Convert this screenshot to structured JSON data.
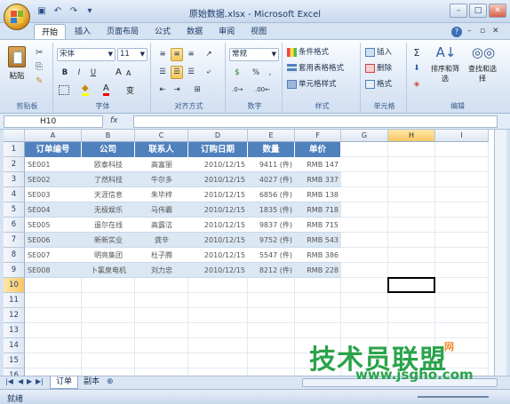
{
  "window": {
    "title": "原始数据.xlsx - Microsoft Excel"
  },
  "tabs": [
    "开始",
    "插入",
    "页面布局",
    "公式",
    "数据",
    "审阅",
    "视图"
  ],
  "ribbon": {
    "clipboard": {
      "paste": "粘贴",
      "label": "剪贴板"
    },
    "font": {
      "name": "宋体",
      "size": "11",
      "bold": "B",
      "italic": "I",
      "underline": "U",
      "label": "字体",
      "wen": "变"
    },
    "alignment": {
      "label": "对齐方式"
    },
    "number": {
      "format": "常规",
      "percent": "%",
      "comma": ",",
      "label": "数字",
      "currency": "$"
    },
    "styles": {
      "conditional": "条件格式",
      "table": "套用表格格式",
      "cell": "单元格样式",
      "label": "样式"
    },
    "cells": {
      "insert": "插入",
      "delete": "删除",
      "format": "格式",
      "label": "单元格"
    },
    "editing": {
      "sort": "排序和筛选",
      "find": "查找和选择",
      "label": "编辑",
      "sigma": "Σ"
    }
  },
  "formula_bar": {
    "name_box": "H10",
    "fx": "fx"
  },
  "columns": [
    "A",
    "B",
    "C",
    "D",
    "E",
    "F",
    "G",
    "H",
    "I"
  ],
  "rows": [
    "1",
    "2",
    "3",
    "4",
    "5",
    "6",
    "7",
    "8",
    "9",
    "10",
    "11",
    "12",
    "13",
    "14",
    "15",
    "16",
    "17"
  ],
  "table": {
    "headers": [
      "订单编号",
      "公司",
      "联系人",
      "订购日期",
      "数量",
      "单价"
    ],
    "rows": [
      [
        "SE001",
        "欧泰科技",
        "高富丽",
        "2010/12/15",
        "9411 (件)",
        "RMB 147"
      ],
      [
        "SE002",
        "了然科技",
        "牛尔多",
        "2010/12/15",
        "4027 (件)",
        "RMB 337"
      ],
      [
        "SE003",
        "天涯信息",
        "朱毕梓",
        "2010/12/15",
        "6856 (件)",
        "RMB 138"
      ],
      [
        "SE004",
        "无极娱乐",
        "马伟霸",
        "2010/12/15",
        "1835 (件)",
        "RMB 718"
      ],
      [
        "SE005",
        "遥尔在线",
        "高露洁",
        "2010/12/15",
        "9837 (件)",
        "RMB 715"
      ],
      [
        "SE006",
        "新新实业",
        "龚辛",
        "2010/12/15",
        "9752 (件)",
        "RMB 543"
      ],
      [
        "SE007",
        "明亮集团",
        "杜子腾",
        "2010/12/15",
        "5547 (件)",
        "RMB 386"
      ],
      [
        "SE008",
        "卜氯泉电机",
        "刘力忠",
        "2010/12/15",
        "8212 (件)",
        "RMB 228"
      ]
    ]
  },
  "sheets": [
    "订单",
    "副本"
  ],
  "status": {
    "ready": "就绪"
  },
  "watermark": {
    "main": "技术员联盟",
    "url": "www.jsgho.com",
    "top": "网"
  },
  "colors": {
    "header_fill": "#4f81bd",
    "band_fill": "#dbe7f3",
    "accent": "#f8c764"
  }
}
